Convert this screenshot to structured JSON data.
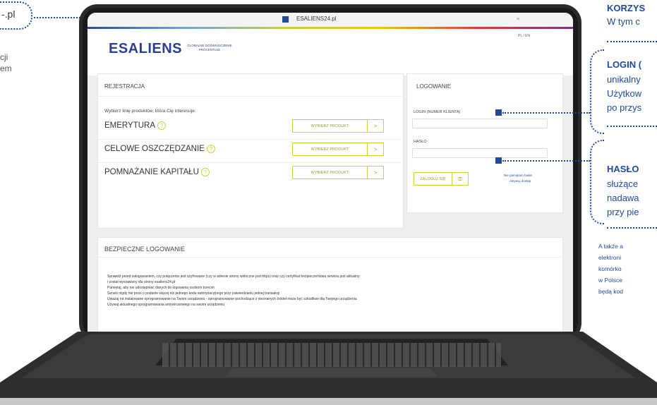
{
  "left_annotation": {
    "label": "-.pl",
    "lines": [
      "cji",
      "em"
    ]
  },
  "browser": {
    "url": "ESALIENS24.pl"
  },
  "site": {
    "logo": "ESALIENS",
    "tagline": "GLOBALNE DOŚWIADCZENIE PROCENTUJE",
    "lang": "PL / EN"
  },
  "registration": {
    "title": "REJESTRACJA",
    "prompt": "Wybierz linię produktów, która Cię interesuje:",
    "products": [
      {
        "name": "EMERYTURA",
        "help": "?",
        "button": "WYBIERZ PRODUKT",
        "chevron": ">"
      },
      {
        "name": "CELOWE OSZCZĘDZANIE",
        "help": "?",
        "button": "WYBIERZ PRODUKT",
        "chevron": ">"
      },
      {
        "name": "POMNAŻANIE KAPITAŁU",
        "help": "?",
        "button": "WYBIERZ PRODUKT",
        "chevron": ">"
      }
    ]
  },
  "login": {
    "title": "LOGOWANIE",
    "login_label": "LOGIN (NUMER KLIENTA)",
    "password_label": "HASŁO",
    "submit": "ZALOGUJ SIĘ",
    "forgot": "Nie pamiętam hasła",
    "first_access": "Aktywuj dostęp"
  },
  "security": {
    "title": "BEZPIECZNE LOGOWANIE",
    "bullets": [
      "Sprawdź przed zalogowaniem, czy połączenie jest szyfrowane (czy w adresie strony widoczne jest https) oraz czy certyfikat bezpieczeństwa serwisu jest aktualny",
      "i został wystawiony dla strony esaliens24.pl",
      "Pamiętaj, aby nie udostępniać danych do logowania osobom trzecim",
      "Serwis nigdy nie prosi o podanie więcej niż jednego kodu autoryzacyjnego przy zatwierdzaniu jednej transakcji",
      "Uważaj na instalowane oprogramowanie na Twoim urządzeniu - oprogramowanie pochodzące z nieznanych źródeł może być szkodliwe dla Twojego urządzenia",
      "Używaj aktualnego oprogramowania antywirusowego na swoim urządzeniu"
    ]
  },
  "annotations": {
    "a1_head": "KORZYS",
    "a1_text": "W tym c",
    "a2_head": "LOGIN (",
    "a2_lines": [
      "unikalny",
      "Użytkow",
      "po przys"
    ],
    "a3_head": "HASŁO",
    "a3_lines": [
      "służące",
      "nadawa",
      "przy pie"
    ],
    "a4_lines": [
      "A także a",
      "elektroni",
      "komórko",
      "w Polsce",
      "będą kod"
    ]
  },
  "colors": {
    "brand_blue": "#1f4a9c",
    "accent_lime": "#c8d33d"
  }
}
